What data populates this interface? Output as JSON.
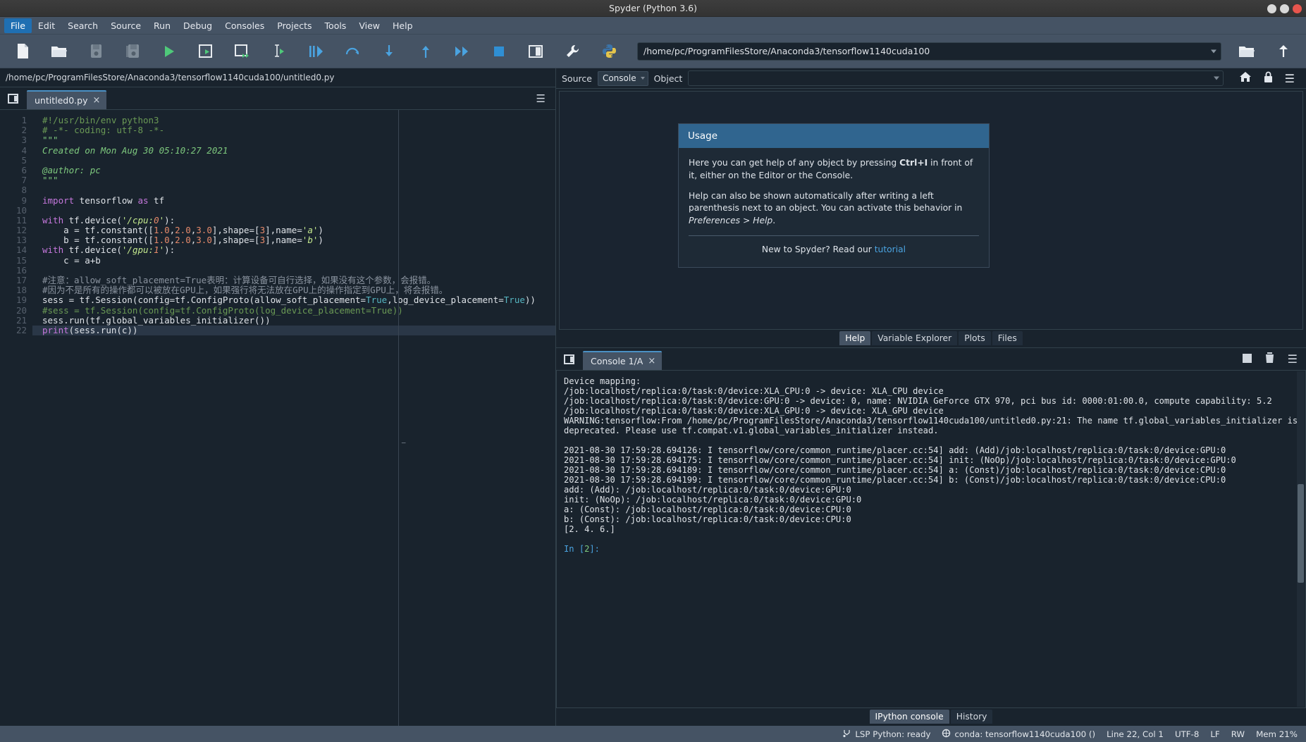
{
  "window": {
    "title": "Spyder (Python 3.6)",
    "controls": [
      "minimize",
      "maximize",
      "close"
    ]
  },
  "menubar": {
    "items": [
      {
        "label": "File",
        "active": true
      },
      {
        "label": "Edit",
        "active": false
      },
      {
        "label": "Search",
        "active": false
      },
      {
        "label": "Source",
        "active": false
      },
      {
        "label": "Run",
        "active": false
      },
      {
        "label": "Debug",
        "active": false
      },
      {
        "label": "Consoles",
        "active": false
      },
      {
        "label": "Projects",
        "active": false
      },
      {
        "label": "Tools",
        "active": false
      },
      {
        "label": "View",
        "active": false
      },
      {
        "label": "Help",
        "active": false
      }
    ]
  },
  "toolbar": {
    "icons": [
      "new-file-icon",
      "open-file-icon",
      "save-file-icon",
      "save-all-icon",
      "run-file-icon",
      "run-cell-icon",
      "run-cell-advance-icon",
      "run-selection-icon",
      "debug-file-icon",
      "debug-step-over-icon",
      "debug-step-into-icon",
      "debug-step-return-icon",
      "debug-continue-icon",
      "stop-debug-icon",
      "maximize-pane-icon",
      "preferences-wrench-icon",
      "python-path-manager-icon"
    ],
    "path_value": "/home/pc/ProgramFilesStore/Anaconda3/tensorflow1140cuda100",
    "trailing_icons": [
      "open-folder-icon",
      "parent-directory-icon"
    ]
  },
  "editor": {
    "file_path": "/home/pc/ProgramFilesStore/Anaconda3/tensorflow1140cuda100/untitled0.py",
    "tab_label": "untitled0.py",
    "tab_close": "×",
    "browse_icon": "file-browse-icon",
    "options_icon": "hamburger-options-icon",
    "line_numbers": [
      1,
      2,
      3,
      4,
      5,
      6,
      7,
      8,
      9,
      10,
      11,
      12,
      13,
      14,
      15,
      16,
      17,
      18,
      19,
      20,
      21,
      22
    ],
    "current_line": 22,
    "code_lines": [
      "#!/usr/bin/env python3",
      "# -*- coding: utf-8 -*-",
      "\"\"\"",
      "Created on Mon Aug 30 05:10:27 2021",
      "",
      "@author: pc",
      "\"\"\"",
      "",
      "import tensorflow as tf",
      "",
      "with tf.device('/cpu:0'):",
      "    a = tf.constant([1.0,2.0,3.0],shape=[3],name='a')",
      "    b = tf.constant([1.0,2.0,3.0],shape=[3],name='b')",
      "with tf.device('/gpu:1'):",
      "    c = a+b",
      "",
      "#注意：allow_soft_placement=True表明：计算设备可自行选择，如果没有这个参数，会报错。",
      "#因为不是所有的操作都可以被放在GPU上，如果强行将无法放在GPU上的操作指定到GPU上，将会报错。",
      "sess = tf.Session(config=tf.ConfigProto(allow_soft_placement=True,log_device_placement=True))",
      "#sess = tf.Session(config=tf.ConfigProto(log_device_placement=True))",
      "sess.run(tf.global_variables_initializer())",
      "print(sess.run(c))"
    ]
  },
  "help": {
    "source_label": "Source",
    "source_value": "Console",
    "object_label": "Object",
    "object_value": "",
    "home_icon": "home-icon",
    "lock_icon": "lock-icon",
    "options_icon": "hamburger-options-icon",
    "usage_title": "Usage",
    "paragraph1_a": "Here you can get help of any object by pressing ",
    "paragraph1_b": "Ctrl+I",
    "paragraph1_c": " in front of it, either on the Editor or the Console.",
    "paragraph2_a": "Help can also be shown automatically after writing a left parenthesis next to an object. You can activate this behavior in ",
    "paragraph2_b": "Preferences > Help",
    "paragraph2_c": ".",
    "footer_text": "New to Spyder? Read our ",
    "footer_link": "tutorial",
    "tabs": [
      {
        "label": "Help",
        "selected": true
      },
      {
        "label": "Variable Explorer",
        "selected": false
      },
      {
        "label": "Plots",
        "selected": false
      },
      {
        "label": "Files",
        "selected": false
      }
    ]
  },
  "console": {
    "browse_icon": "file-browse-icon",
    "tab_label": "Console 1/A",
    "tab_close": "×",
    "tool_icons": [
      "stop-icon",
      "remove-all-variables-icon",
      "hamburger-options-icon"
    ],
    "output_lines": [
      "Device mapping:",
      "/job:localhost/replica:0/task:0/device:XLA_CPU:0 -> device: XLA_CPU device",
      "/job:localhost/replica:0/task:0/device:GPU:0 -> device: 0, name: NVIDIA GeForce GTX 970, pci bus id: 0000:01:00.0, compute capability: 5.2",
      "/job:localhost/replica:0/task:0/device:XLA_GPU:0 -> device: XLA_GPU device",
      "WARNING:tensorflow:From /home/pc/ProgramFilesStore/Anaconda3/tensorflow1140cuda100/untitled0.py:21: The name tf.global_variables_initializer is deprecated. Please use tf.compat.v1.global_variables_initializer instead.",
      "",
      "2021-08-30 17:59:28.694126: I tensorflow/core/common_runtime/placer.cc:54] add: (Add)/job:localhost/replica:0/task:0/device:GPU:0",
      "2021-08-30 17:59:28.694175: I tensorflow/core/common_runtime/placer.cc:54] init: (NoOp)/job:localhost/replica:0/task:0/device:GPU:0",
      "2021-08-30 17:59:28.694189: I tensorflow/core/common_runtime/placer.cc:54] a: (Const)/job:localhost/replica:0/task:0/device:CPU:0",
      "2021-08-30 17:59:28.694199: I tensorflow/core/common_runtime/placer.cc:54] b: (Const)/job:localhost/replica:0/task:0/device:CPU:0",
      "add: (Add): /job:localhost/replica:0/task:0/device:GPU:0",
      "init: (NoOp): /job:localhost/replica:0/task:0/device:GPU:0",
      "a: (Const): /job:localhost/replica:0/task:0/device:CPU:0",
      "b: (Const): /job:localhost/replica:0/task:0/device:CPU:0",
      "[2. 4. 6.]"
    ],
    "prompt_prefix": "In [",
    "prompt_number": "2",
    "prompt_suffix": "]:",
    "tabs": [
      {
        "label": "IPython console",
        "selected": true
      },
      {
        "label": "History",
        "selected": false
      }
    ]
  },
  "statusbar": {
    "lsp_icon": "lsp-status-icon",
    "lsp_text": "LSP Python: ready",
    "conda_icon": "conda-env-icon",
    "conda_text": "conda: tensorflow1140cuda100 ()",
    "cursor_text": "Line 22, Col 1",
    "encoding_text": "UTF-8",
    "eol_text": "LF",
    "rw_text": "RW",
    "memory_text": "Mem 21%"
  },
  "colors": {
    "accent": "#4a90c4",
    "menu_active": "#1f6fb2",
    "panel_bg": "#19232d",
    "chrome_bg": "#455364",
    "usage_header": "#30658f",
    "run_green": "#4fc97a",
    "link": "#4aa3e0"
  }
}
